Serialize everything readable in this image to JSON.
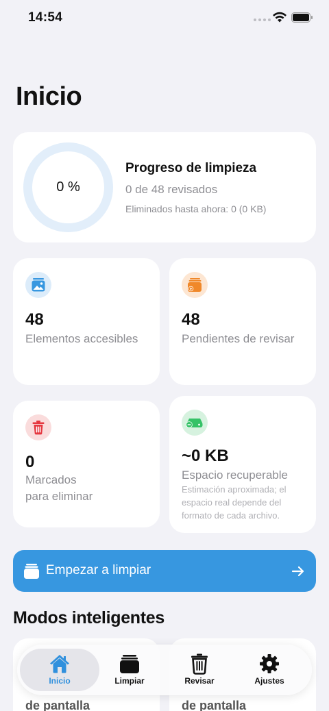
{
  "status_bar": {
    "time": "14:54"
  },
  "page_title": "Inicio",
  "progress": {
    "percent_label": "0 %",
    "percent": 0,
    "title": "Progreso de limpieza",
    "reviewed": "0 de 48 revisados",
    "deleted_so_far": "Eliminados hasta ahora: 0 (0 KB)"
  },
  "stats": {
    "accessible": {
      "value": "48",
      "label": "Elementos accesibles",
      "icon": "photo-icon"
    },
    "pending": {
      "value": "48",
      "label": "Pendientes de revisar",
      "icon": "video-stack-icon"
    },
    "marked": {
      "value": "0",
      "label_line1": "Marcados",
      "label_line2": "para eliminar",
      "icon": "trash-icon"
    },
    "space": {
      "value": "~0 KB",
      "label": "Espacio recuperable",
      "note": "Estimación aproximada; el espacio real depende del formato de cada archivo.",
      "icon": "storage-icon"
    }
  },
  "start_button": {
    "label": "Empezar a limpiar"
  },
  "section_title": "Modos inteligentes",
  "modes": [
    {
      "label": "de pantalla"
    },
    {
      "label": "de pantalla"
    }
  ],
  "tab_bar": {
    "tabs": [
      {
        "label": "Inicio",
        "icon": "house-icon"
      },
      {
        "label": "Limpiar",
        "icon": "stack-icon"
      },
      {
        "label": "Revisar",
        "icon": "trash-icon"
      },
      {
        "label": "Ajustes",
        "icon": "gear-icon"
      }
    ]
  },
  "colors": {
    "accent": "#3797e0",
    "blue_tint": "#dcecfa",
    "orange": "#f0882a",
    "red": "#e5373f",
    "green": "#35c267"
  }
}
